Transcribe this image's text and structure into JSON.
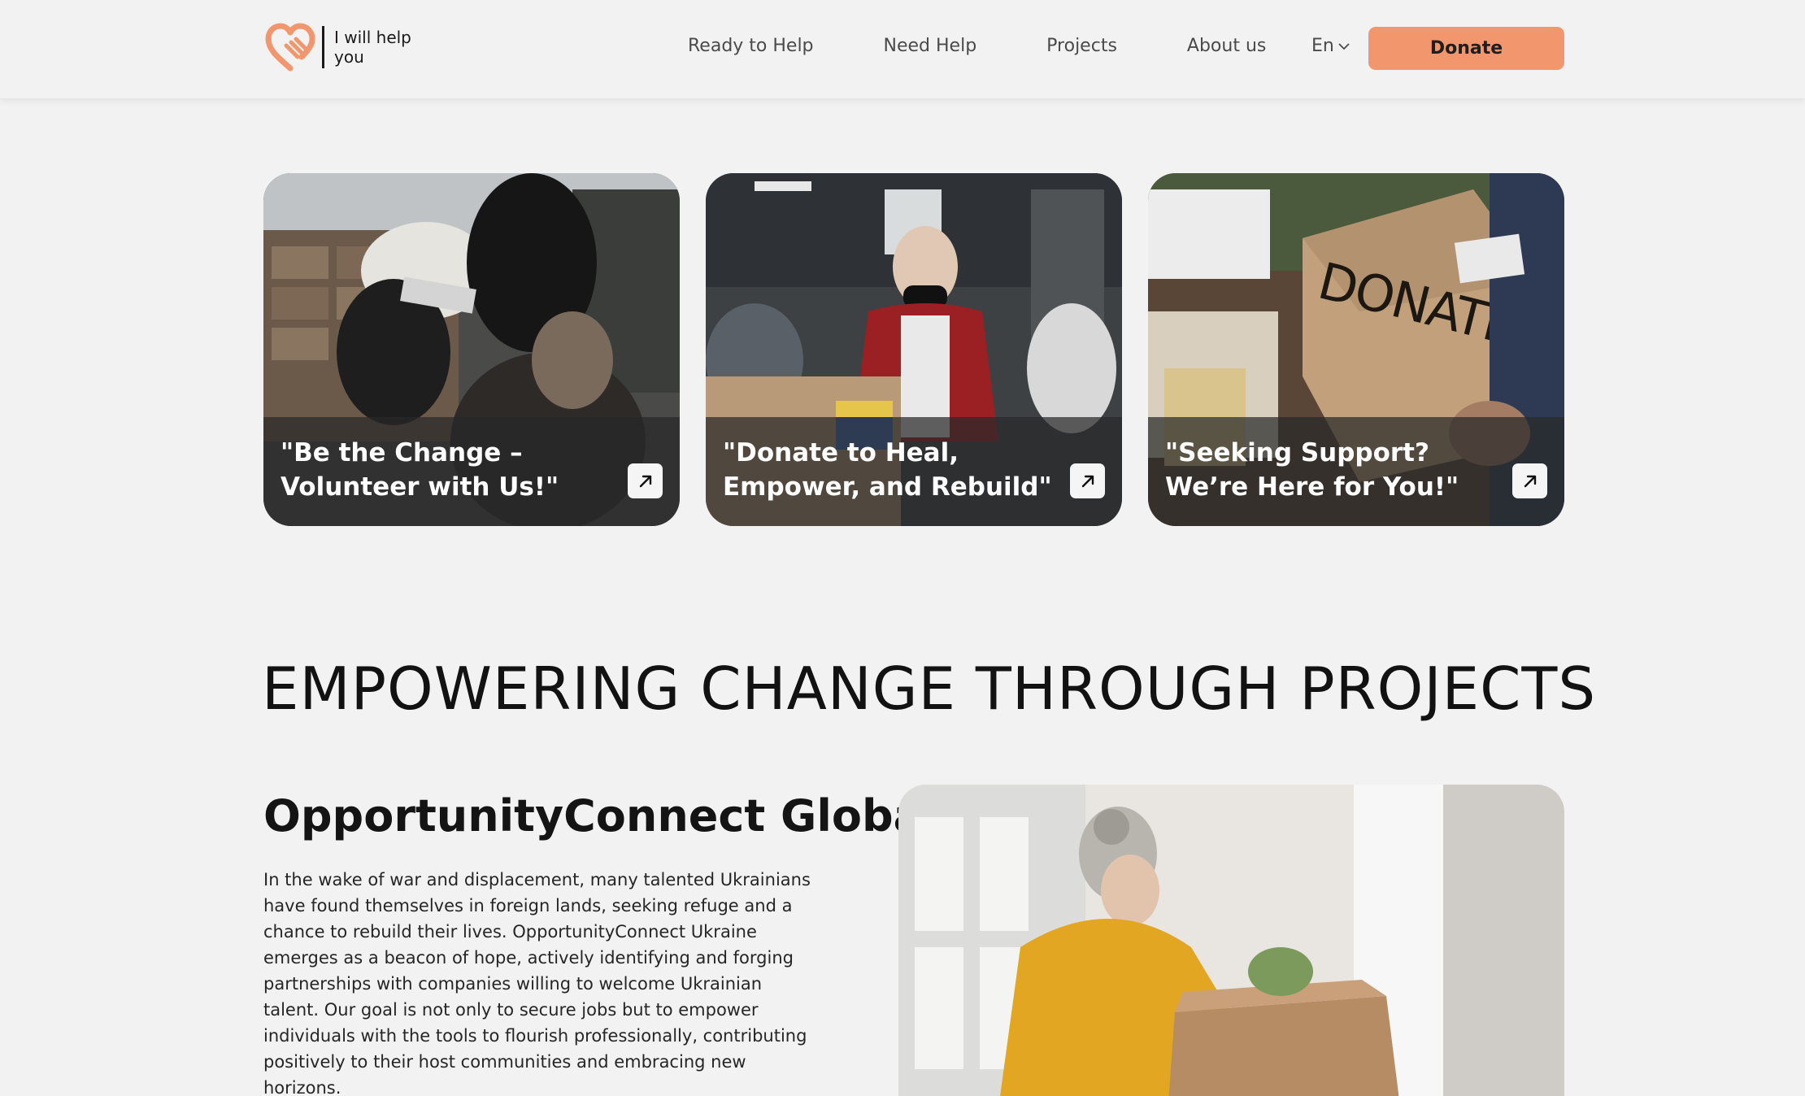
{
  "header": {
    "logo_text": "I will help you",
    "nav": [
      "Ready to Help",
      "Need Help",
      "Projects",
      "About us"
    ],
    "language": "En",
    "donate_label": "Donate"
  },
  "cards": [
    {
      "title": "\"Be the Change – Volunteer with Us!\"",
      "icon": "arrow-up-right-icon"
    },
    {
      "title": "\"Donate to Heal, Empower, and Rebuild\"",
      "icon": "arrow-up-right-icon"
    },
    {
      "title": "\"Seeking Support? We’re Here for You!\"",
      "icon": "arrow-up-right-icon"
    }
  ],
  "section": {
    "title": "EMPOWERING CHANGE THROUGH PROJECTS"
  },
  "project": {
    "title": "OpportunityConnect Global",
    "description": "In the wake of war and displacement, many talented Ukrainians have found themselves in foreign lands, seeking refuge and a chance to rebuild their lives. OpportunityConnect Ukraine emerges as a beacon of hope, actively identifying and forging partnerships with companies willing to welcome Ukrainian talent. Our goal is not only to secure jobs but to empower individuals with the tools to flourish professionally, contributing positively to their host communities and embracing new horizons."
  },
  "colors": {
    "accent": "#f2966e",
    "background": "#f2f2f2",
    "text": "#1a1a1a"
  }
}
